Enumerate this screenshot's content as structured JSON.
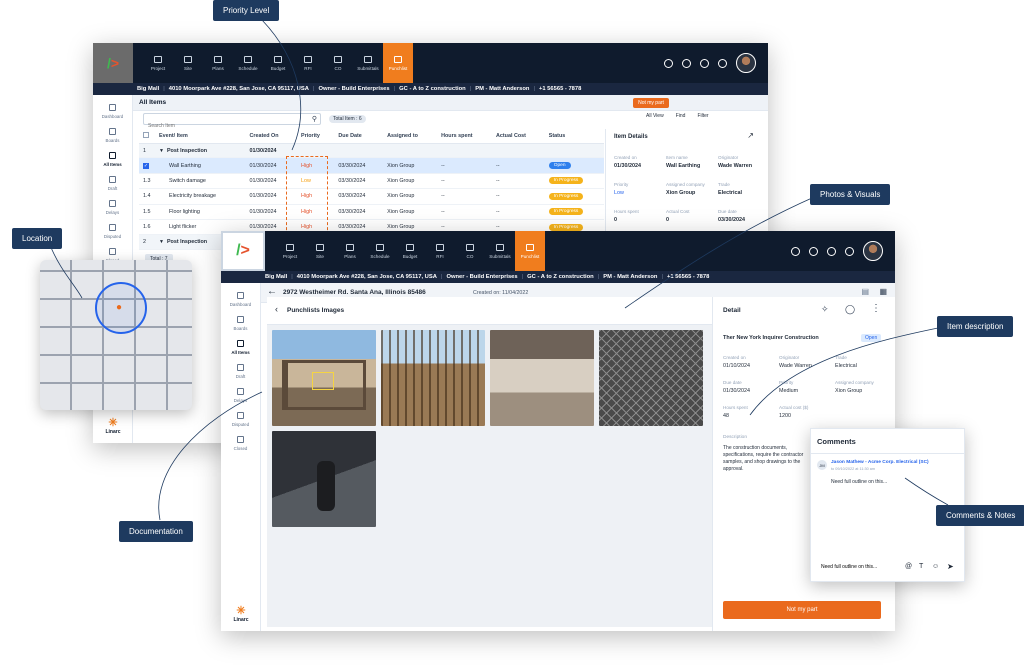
{
  "callouts": {
    "priority_level": "Priority Level",
    "location": "Location",
    "photos_visuals": "Photos & Visuals",
    "item_description": "Item description",
    "documentation": "Documentation",
    "comments_notes": "Comments & Notes"
  },
  "app": {
    "brand": "Linarc",
    "nav": [
      "Project",
      "Site",
      "Plans",
      "Schedule",
      "Budget",
      "RFI",
      "CO",
      "Submittals",
      "Punchlist"
    ],
    "active_nav": "Punchlist",
    "project_bar": [
      "Big Mall",
      "4010 Moorpark Ave #228, San Jose, CA 95117, USA",
      "Owner - Build Enterprises",
      "GC - A to Z construction",
      "PM - Matt Anderson",
      "+1 56565 - 7878"
    ],
    "sidebar": [
      "Dashboard",
      "Boards",
      "All Items",
      "Draft",
      "Delays",
      "Disputed",
      "Closed"
    ],
    "sidebar_active": "All Items"
  },
  "back_window": {
    "title": "All Items",
    "not_my_part": "Not my part",
    "search_placeholder": "Search Item",
    "total_items": "Total Item : 6",
    "all_view": "All View",
    "find": "Find",
    "filter": "Filter",
    "columns": [
      "Event/ Item",
      "Created On",
      "Priority",
      "Due Date",
      "Assigned to",
      "Hours spent",
      "Actual Cost",
      "Status"
    ],
    "rows": [
      {
        "num": "1",
        "item": "Post Inspection",
        "created": "01/30/2024",
        "priority": "",
        "due": "",
        "assigned": "",
        "hours": "",
        "cost": "",
        "status": "",
        "group": true
      },
      {
        "num": "",
        "item": "Wall Earthing",
        "created": "01/30/2024",
        "priority": "High",
        "due": "03/30/2024",
        "assigned": "Xion Group",
        "hours": "--",
        "cost": "--",
        "status": "Open",
        "selected": true
      },
      {
        "num": "1.3",
        "item": "Switch damage",
        "created": "01/30/2024",
        "priority": "Low",
        "due": "03/30/2024",
        "assigned": "Xion Group",
        "hours": "--",
        "cost": "--",
        "status": "In Progress"
      },
      {
        "num": "1.4",
        "item": "Electricity breakage",
        "created": "01/30/2024",
        "priority": "High",
        "due": "03/30/2024",
        "assigned": "Xion Group",
        "hours": "--",
        "cost": "--",
        "status": "In Progress"
      },
      {
        "num": "1.5",
        "item": "Floor lighting",
        "created": "01/30/2024",
        "priority": "High",
        "due": "03/30/2024",
        "assigned": "Xion Group",
        "hours": "--",
        "cost": "--",
        "status": "In Progress"
      },
      {
        "num": "1.6",
        "item": "Light flicker",
        "created": "01/30/2024",
        "priority": "High",
        "due": "03/30/2024",
        "assigned": "Xion Group",
        "hours": "--",
        "cost": "--",
        "status": "In Progress"
      },
      {
        "num": "2",
        "item": "Post Inspection",
        "created": "",
        "priority": "",
        "due": "",
        "assigned": "",
        "hours": "",
        "cost": "",
        "status": "",
        "group": true
      }
    ],
    "footer_total": "Total : 7",
    "details": {
      "title": "Item Details",
      "fields": [
        {
          "k": "Created on",
          "v": "01/30/2024"
        },
        {
          "k": "Item name",
          "v": "Wall Earthing"
        },
        {
          "k": "Originator",
          "v": "Wade Warren"
        },
        {
          "k": "Priority",
          "v": "Low"
        },
        {
          "k": "Assigned company",
          "v": "Xion Group"
        },
        {
          "k": "Trade",
          "v": "Electrical"
        },
        {
          "k": "Hours spent",
          "v": "0"
        },
        {
          "k": "Actual Cost",
          "v": "0"
        },
        {
          "k": "Due date",
          "v": "03/30/2024"
        }
      ]
    }
  },
  "front_window": {
    "address": "2972 Westheimer Rd. Santa Ana, Illinois 85486",
    "created_on": "Created on: 11/04/2022",
    "images_title": "Punchlists Images",
    "detail": {
      "title": "Detail",
      "company": "Ther New York Inquirer Construction",
      "status": "Open",
      "fields": [
        {
          "k": "Created on",
          "v": "01/10/2024"
        },
        {
          "k": "Originator",
          "v": "Wade Warren"
        },
        {
          "k": "Trade",
          "v": "Electrical"
        },
        {
          "k": "Due date",
          "v": "01/30/2024"
        },
        {
          "k": "Priority",
          "v": "Medium"
        },
        {
          "k": "Assigned company",
          "v": "Xion Group"
        },
        {
          "k": "Hours spent",
          "v": "48"
        },
        {
          "k": "Actual cost ($)",
          "v": "1200"
        }
      ],
      "description_label": "Description",
      "description": "The construction documents, specifications, require the contractor samples, and shop drawings to the approval.",
      "not_my_part": "Not my part"
    }
  },
  "comments": {
    "title": "Comments",
    "author": "Jason Mathew - Acme Corp. Electrical (SC)",
    "initials": "JM",
    "time": "to 09/10/2022 at 11:30 am",
    "text": "Need full outline on this...",
    "input_value": "Need full outline on this..."
  }
}
